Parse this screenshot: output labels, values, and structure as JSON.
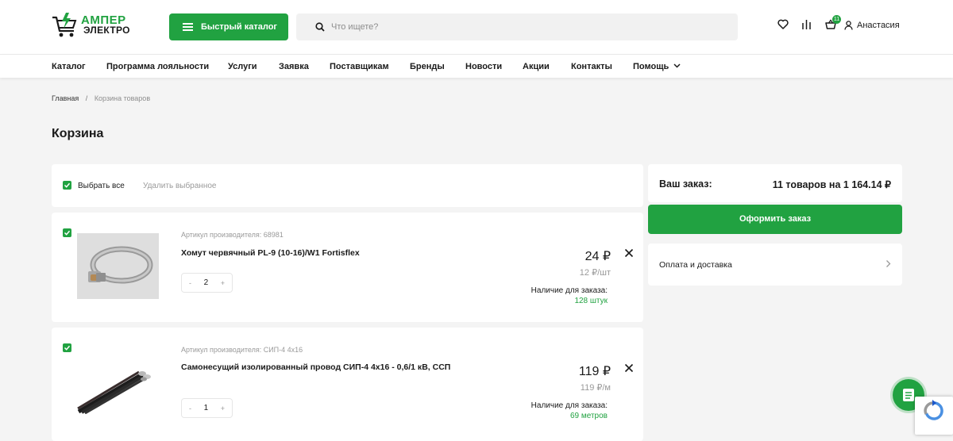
{
  "header": {
    "logo_line1": "АМПЕР",
    "logo_line2": "ЭЛЕКТРО",
    "catalog_button": "Быстрый каталог",
    "search_placeholder": "Что ищете?",
    "cart_count": "11",
    "user_name": "Анастасия"
  },
  "nav": {
    "items": [
      "Каталог",
      "Программа лояльности",
      "Услуги",
      "Заявка",
      "Поставщикам",
      "Бренды",
      "Новости",
      "Акции",
      "Контакты",
      "Помощь"
    ]
  },
  "breadcrumb": {
    "home": "Главная",
    "separator": "/",
    "current": "Корзина товаров"
  },
  "page_title": "Корзина",
  "cart_controls": {
    "select_all": "Выбрать все",
    "select_all_checked": true,
    "delete_selected": "Удалить выбранное"
  },
  "items": [
    {
      "checked": true,
      "article": "Артикул производителя: 68981",
      "name": "Хомут червячный PL-9 (10-16)/W1 Fortisflex",
      "quantity": "2",
      "qty_minus": "-",
      "qty_plus": "+",
      "price": "24 ₽",
      "unit_price": "12 ₽/шт",
      "availability_label": "Наличие для заказа:",
      "availability_value": "128 штук"
    },
    {
      "checked": true,
      "article": "Артикул производителя: СИП-4 4х16",
      "name": "Самонесущий изолированный провод СИП-4 4х16 - 0,6/1 кВ, ССП",
      "quantity": "1",
      "qty_minus": "-",
      "qty_plus": "+",
      "price": "119 ₽",
      "unit_price": "119 ₽/м",
      "availability_label": "Наличие для заказа:",
      "availability_value": "69 метров"
    }
  ],
  "summary": {
    "label": "Ваш заказ:",
    "total": "11 товаров на 1 164.14 ₽",
    "order_button": "Оформить заказ",
    "delivery_link": "Оплата и доставка"
  },
  "colors": {
    "accent": "#21a241",
    "background": "#f4f4f4"
  }
}
